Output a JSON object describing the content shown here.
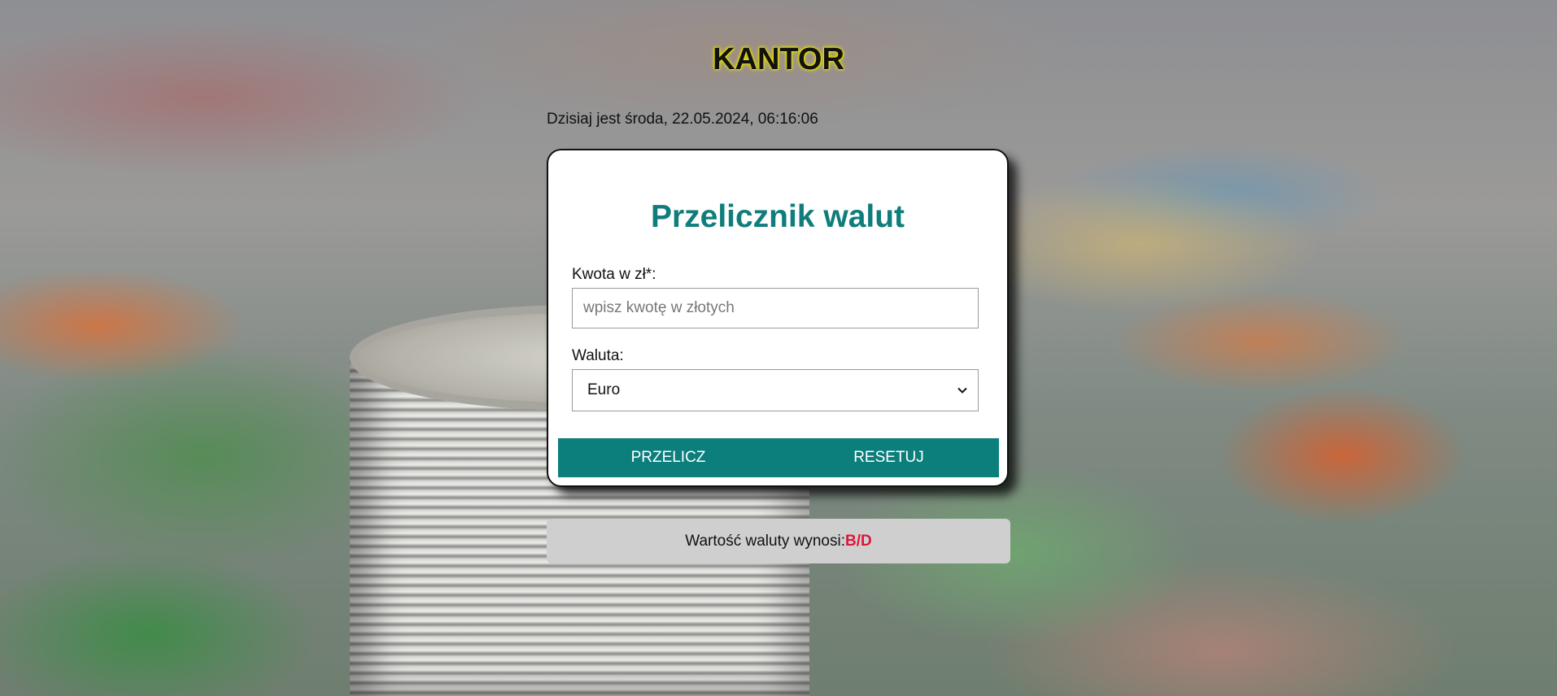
{
  "header": {
    "title": "KANTOR",
    "date_text": "Dzisiaj jest środa, 22.05.2024, 06:16:06"
  },
  "converter": {
    "title": "Przelicznik walut",
    "amount_label": "Kwota w zł*:",
    "amount_placeholder": "wpisz kwotę w złotych",
    "amount_value": "",
    "currency_label": "Waluta:",
    "currency_selected": "Euro",
    "convert_button": "PRZELICZ",
    "reset_button": "RESETUJ"
  },
  "result": {
    "label": "Wartość waluty wynosi:",
    "value": "B/D"
  },
  "colors": {
    "accent": "#0c7f7d",
    "title_glow": "#e6e000",
    "result_value": "#e0143c",
    "result_bg": "#cfcfcf"
  }
}
